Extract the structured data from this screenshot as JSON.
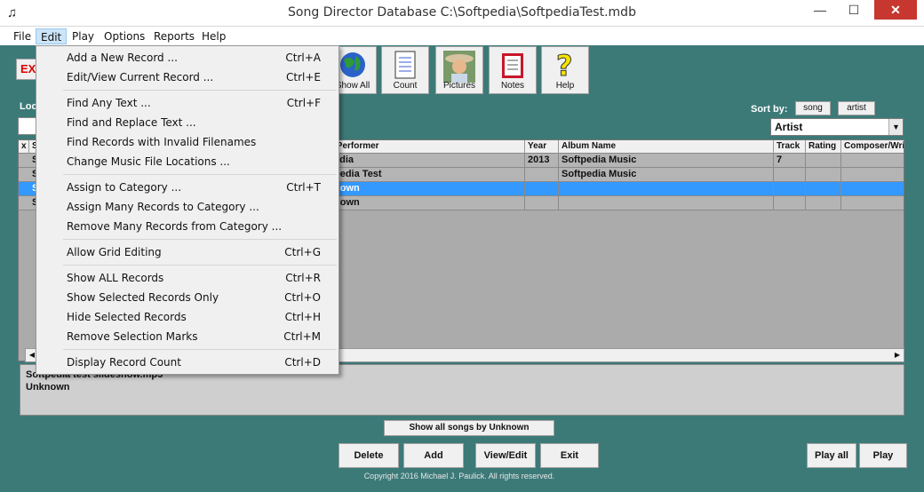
{
  "window": {
    "title": "Song Director Database  C:\\Softpedia\\SoftpediaTest.mdb",
    "minimize": "—",
    "maximize": "☐",
    "close": "✕"
  },
  "menubar": [
    "File",
    "Edit",
    "Play",
    "Options",
    "Reports",
    "Help"
  ],
  "toolbar": {
    "exit_label": "EXI",
    "buttons": [
      {
        "label": "Show All",
        "icon": "globe-icon"
      },
      {
        "label": "Count",
        "icon": "notepad-icon"
      },
      {
        "label": "Pictures",
        "icon": "photo-icon"
      },
      {
        "label": "Notes",
        "icon": "notebook-icon"
      },
      {
        "label": "Help",
        "icon": "question-icon"
      }
    ]
  },
  "locate_label": "Loc",
  "sort": {
    "label": "Sort by:",
    "song_button": "song",
    "artist_button": "artist",
    "selected": "Artist"
  },
  "grid": {
    "headers": [
      "x",
      "S",
      "/Performer",
      "Year",
      "Album Name",
      "Track",
      "Rating",
      "Composer/Wri"
    ],
    "rows": [
      {
        "c1": "S",
        "performer": "edia",
        "year": "2013",
        "album": "Softpedia Music",
        "track": "7",
        "rating": "",
        "composer": ""
      },
      {
        "c1": "S",
        "performer": "pedia Test",
        "year": "",
        "album": "Softpedia Music",
        "track": "",
        "rating": "",
        "composer": ""
      },
      {
        "c1": "S",
        "performer": "nown",
        "year": "",
        "album": "",
        "track": "",
        "rating": "",
        "composer": ""
      },
      {
        "c1": "S",
        "performer": "nown",
        "year": "",
        "album": "",
        "track": "",
        "rating": "",
        "composer": ""
      }
    ]
  },
  "info": {
    "line1": "Softpedia test slideshow.mp3",
    "line2": "Unknown"
  },
  "buttons": {
    "show_all_by": "Show all songs by Unknown",
    "delete": "Delete",
    "add": "Add",
    "view_edit": "View/Edit",
    "exit": "Exit",
    "play_all": "Play all",
    "play": "Play"
  },
  "copyright": "Copyright 2016 Michael J. Paulick.  All rights reserved.",
  "edit_menu": [
    {
      "label": "Add a New Record ...",
      "shortcut": "Ctrl+A"
    },
    {
      "label": "Edit/View Current Record ...",
      "shortcut": "Ctrl+E"
    },
    {
      "label": "Find Any Text ...",
      "shortcut": "Ctrl+F"
    },
    {
      "label": "Find and Replace Text ...",
      "shortcut": ""
    },
    {
      "label": "Find Records with Invalid Filenames",
      "shortcut": ""
    },
    {
      "label": "Change Music File Locations ...",
      "shortcut": ""
    },
    {
      "label": "Assign to Category ...",
      "shortcut": "Ctrl+T"
    },
    {
      "label": "Assign Many Records to Category ...",
      "shortcut": ""
    },
    {
      "label": "Remove Many Records from Category ...",
      "shortcut": ""
    },
    {
      "label": "Allow Grid Editing",
      "shortcut": "Ctrl+G"
    },
    {
      "label": "Show ALL Records",
      "shortcut": "Ctrl+R"
    },
    {
      "label": "Show Selected Records Only",
      "shortcut": "Ctrl+O"
    },
    {
      "label": "Hide Selected Records",
      "shortcut": "Ctrl+H"
    },
    {
      "label": "Remove Selection Marks",
      "shortcut": "Ctrl+M"
    },
    {
      "label": "Display Record Count",
      "shortcut": "Ctrl+D"
    }
  ]
}
